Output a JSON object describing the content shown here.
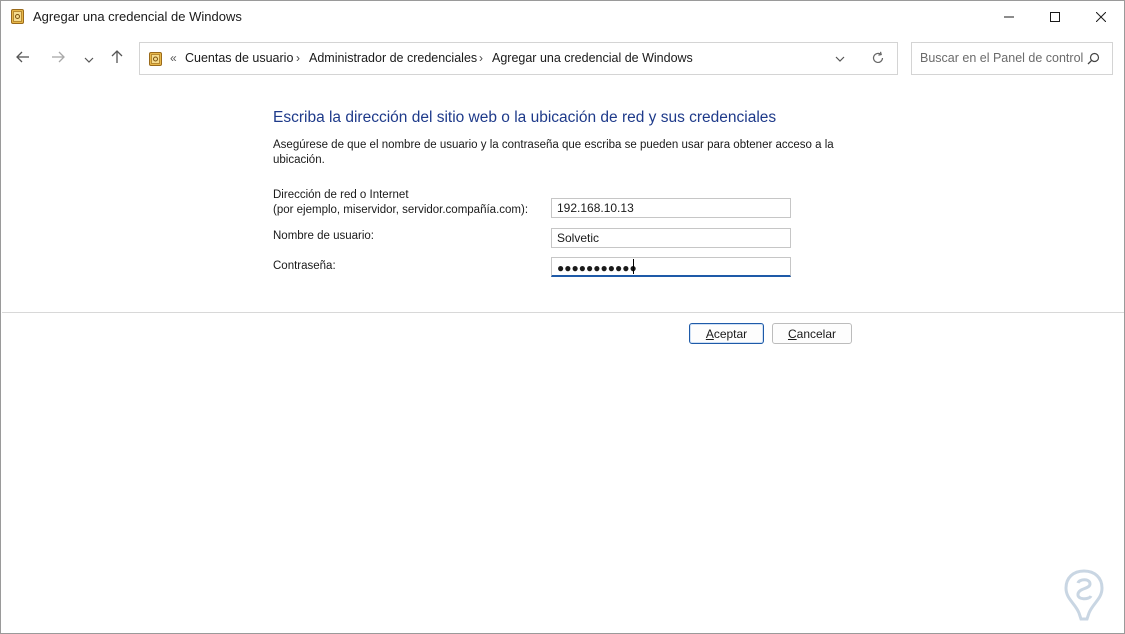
{
  "window": {
    "title": "Agregar una credencial de Windows",
    "app_icon": "credential-manager-icon"
  },
  "titlebar_buttons": [
    "minimize-icon",
    "maximize-icon",
    "close-icon"
  ],
  "nav": {
    "back_icon": "arrow-left-icon",
    "forward_icon": "arrow-right-icon",
    "recent_icon": "chevron-down-icon",
    "up_icon": "arrow-up-icon"
  },
  "address": {
    "overflow": "«",
    "crumbs": [
      "Cuentas de usuario",
      "Administrador de credenciales",
      "Agregar una credencial de Windows"
    ],
    "separator": "›"
  },
  "search": {
    "placeholder": "Buscar en el Panel de control"
  },
  "content": {
    "heading": "Escriba la dirección del sitio web o la ubicación de red y sus credenciales",
    "description": "Asegúrese de que el nombre de usuario y la contraseña que escriba se pueden usar para obtener acceso a la ubicación.",
    "address_label_1": "Dirección de red o Internet",
    "address_label_2": "(por ejemplo, miservidor, servidor.compañía.com):",
    "address_value": "192.168.10.13",
    "username_label": "Nombre de usuario:",
    "username_value": "Solvetic",
    "password_label": "Contraseña:",
    "password_masked": "●●●●●●●●●●●"
  },
  "buttons": {
    "accept_accel": "A",
    "accept_rest": "ceptar",
    "cancel_accel": "C",
    "cancel_rest": "ancelar"
  },
  "colors": {
    "heading": "#1e3a8a",
    "focus": "#1e5aa8"
  }
}
